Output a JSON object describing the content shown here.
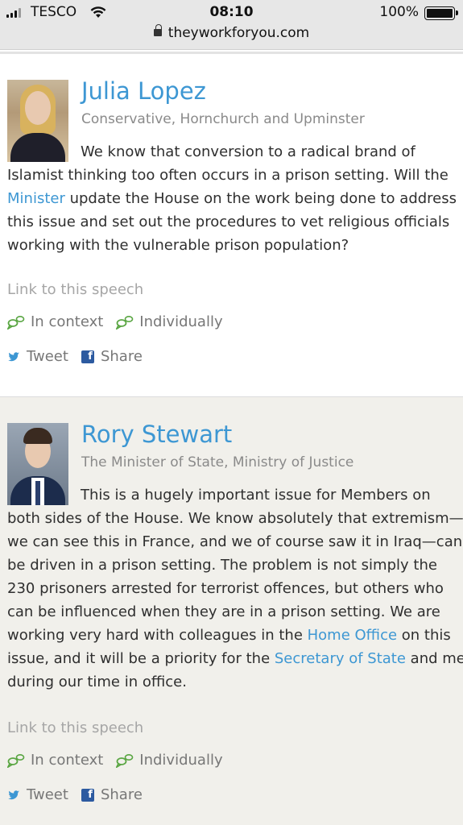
{
  "status_bar": {
    "carrier": "TESCO",
    "time": "08:10",
    "battery": "100%",
    "url": "theyworkforyou.com"
  },
  "speeches": [
    {
      "speaker": "Julia Lopez",
      "role": "Conservative, Hornchurch and Upminster",
      "lines": [
        "We know that conversion to a radical brand of",
        "Islamist thinking too often occurs in a prison setting. Will the",
        "Minister",
        " update the House on the work being done to address",
        "this issue and set out the procedures to vet religious officials",
        "working with the vulnerable prison population?"
      ],
      "link_to_speech": "Link to this speech",
      "in_context": "In context",
      "individually": "Individually",
      "tweet": "Tweet",
      "share": "Share"
    },
    {
      "speaker": "Rory Stewart",
      "role": "The Minister of State, Ministry of Justice",
      "lines": [
        "This is a hugely important issue for Members on",
        "both sides of the House. We know absolutely that extremism—",
        "we can see this in France, and we of course saw it in Iraq—can",
        "be driven in a prison setting. The problem is not simply the",
        "230 prisoners arrested for terrorist offences, but others who",
        "can be influenced when they are in a prison setting. We are",
        "working very hard with colleagues in the ",
        "Home Office",
        " on this",
        "issue, and it will be a priority for the ",
        "Secretary of State",
        " and me",
        "during our time in office."
      ],
      "link_to_speech": "Link to this speech",
      "in_context": "In context",
      "individually": "Individually",
      "tweet": "Tweet",
      "share": "Share"
    }
  ],
  "colors": {
    "link": "#3d97d3",
    "alt_background": "#f1f0eb",
    "context_icon": "#5aa643",
    "twitter": "#3d97d3",
    "facebook": "#2c5aa0"
  },
  "icons": {
    "context": "speech-bubbles-icon",
    "twitter": "twitter-bird-icon",
    "facebook": "facebook-icon"
  }
}
